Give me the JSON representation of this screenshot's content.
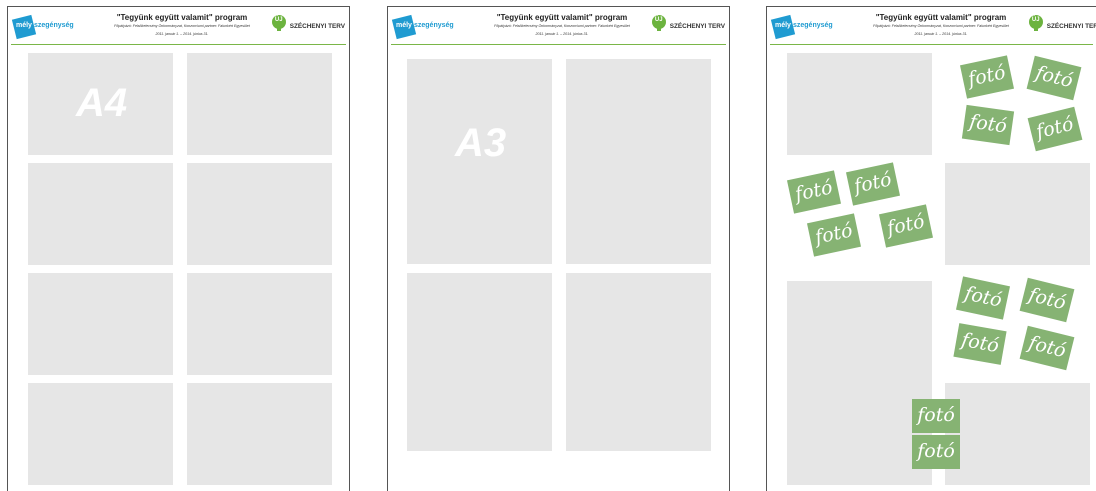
{
  "header": {
    "logo_left_text_a": "mély",
    "logo_left_text_b": "szegénység",
    "title": "\"Tegyünk együtt valamit\" program",
    "subtitle_line1": "Főpályázó: Felsőkelecsény Önkormányzat, Konzorciumi partner: Falunkért Egyesület",
    "subtitle_line2": "2011. január 1. – 2014. június 31.",
    "badge_icon_text": "ÚJ",
    "badge_text": "SZÉCHENYI TERV"
  },
  "pages": [
    {
      "id": "a4",
      "label": "A4"
    },
    {
      "id": "a3",
      "label": "A3"
    },
    {
      "id": "photos",
      "photo_label": "fotó"
    }
  ],
  "colors": {
    "placeholder": "#e6e6e6",
    "photo": "#86b373",
    "accent": "#1f9bd1",
    "green_line": "#7ab648"
  }
}
